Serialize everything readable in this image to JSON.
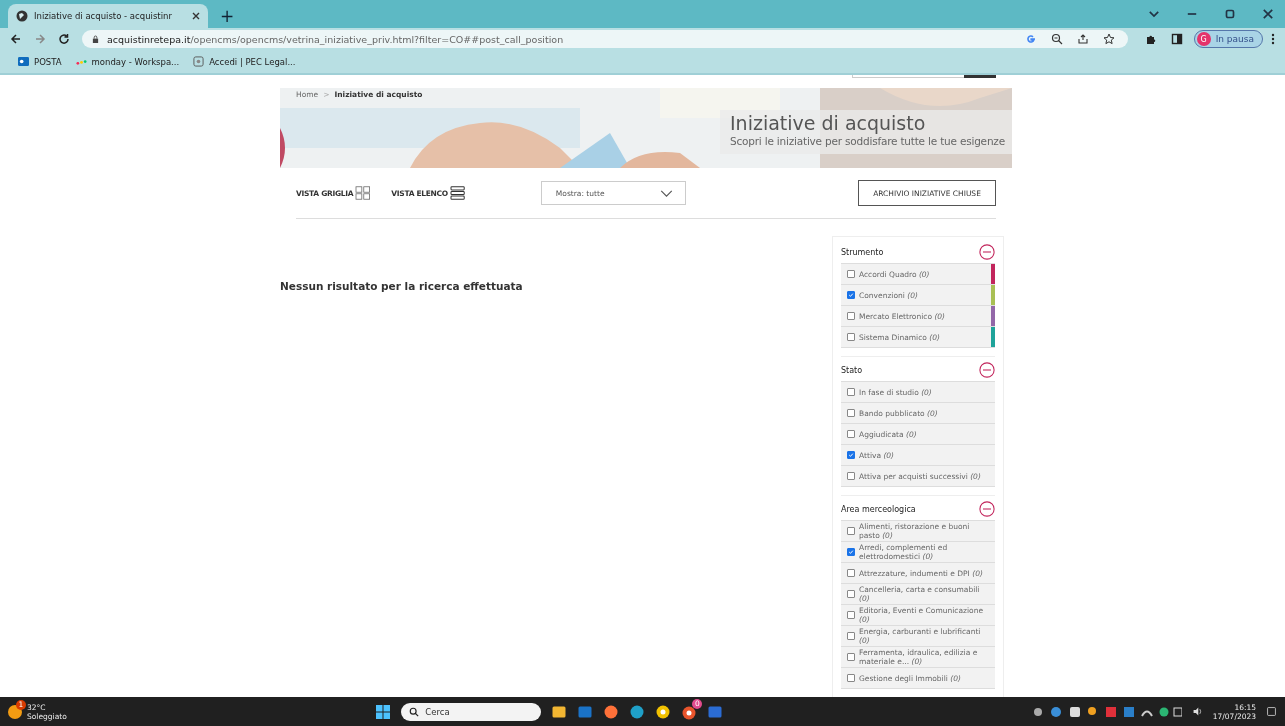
{
  "browser": {
    "tab": {
      "title": "Iniziative di acquisto - acquistinr",
      "selected": true
    },
    "new_tab": "+",
    "url": {
      "host": "acquistinretepa.it",
      "path": "/opencms/opencms/vetrina_iniziative_priv.html?filter=CO##post_call_position"
    },
    "profile": {
      "initial": "G",
      "status": "In pausa"
    },
    "bookmarks": [
      {
        "label": "POSTA",
        "kind": "outlook"
      },
      {
        "label": "monday - Workspa...",
        "kind": "monday"
      },
      {
        "label": "Accedi | PEC Legal...",
        "kind": "pec"
      }
    ]
  },
  "breadcrumb": [
    {
      "label": "Home",
      "current": false
    },
    {
      "label": "Iniziative di acquisto",
      "current": true
    }
  ],
  "breadcrumb_separator": ">",
  "banner": {
    "title": "Iniziative di acquisto",
    "subtitle": "Scopri le iniziative per soddisfare tutte le tue esigenze"
  },
  "toolbar": {
    "views": [
      {
        "label": "VISTA GRIGLIA",
        "kind": "grid"
      },
      {
        "label": "VISTA ELENCO",
        "kind": "list"
      }
    ],
    "filter": {
      "value": "Mostra: tutte"
    },
    "archive_button": "ARCHIVIO INIZIATIVE CHIUSE"
  },
  "message": "Nessun risultato per la ricerca effettuata",
  "filters": [
    {
      "title": "Strumento",
      "expanded": true,
      "items": [
        {
          "label": "Accordi Quadro *(0)*",
          "checked": false,
          "color": "#c2255c"
        },
        {
          "label": "Convenzioni *(0)*",
          "checked": true,
          "color": "#a9bf54"
        },
        {
          "label": "Mercato Elettronico *(0)*",
          "checked": false,
          "color": "#9367a8"
        },
        {
          "label": "Sistema Dinamico *(0)*",
          "checked": false,
          "color": "#1fa39a"
        }
      ]
    },
    {
      "title": "Stato",
      "expanded": true,
      "items": [
        {
          "label": "In fase di studio *(0)*",
          "checked": false
        },
        {
          "label": "Bando pubblicato *(0)*",
          "checked": false
        },
        {
          "label": "Aggiudicata *(0)*",
          "checked": false
        },
        {
          "label": "Attiva *(0)*",
          "checked": true
        },
        {
          "label": "Attiva per acquisti successivi *(0)*",
          "checked": false
        }
      ]
    },
    {
      "title": "Area merceologica",
      "expanded": true,
      "items": [
        {
          "label": "Alimenti, ristorazione e buoni pasto *(0)*",
          "checked": false
        },
        {
          "label": "Arredi, complementi ed elettrodomestici *(0)*",
          "checked": true
        },
        {
          "label": "Attrezzature, indumenti e DPI *(0)*",
          "checked": false
        },
        {
          "label": "Cancelleria, carta e consumabili *(0)*",
          "checked": false
        },
        {
          "label": "Editoria, Eventi e Comunicazione *(0)*",
          "checked": false
        },
        {
          "label": "Energia, carburanti e lubrificanti *(0)*",
          "checked": false
        },
        {
          "label": "Ferramenta, idraulica, edilizia e materiale e... *(0)*",
          "checked": false
        },
        {
          "label": "Gestione degli Immobili *(0)*",
          "checked": false
        }
      ]
    }
  ],
  "taskbar": {
    "weather": {
      "temp": "32°C",
      "condition": "Soleggiato",
      "badge": "1"
    },
    "search": "Cerca",
    "apps": [
      {
        "kind": "files"
      },
      {
        "kind": "outlook"
      },
      {
        "kind": "firefox"
      },
      {
        "kind": "edge"
      },
      {
        "kind": "chrome"
      },
      {
        "kind": "chrome-badge",
        "badge": "0"
      },
      {
        "kind": "word"
      }
    ],
    "time": "16:15",
    "date": "17/07/2023"
  }
}
